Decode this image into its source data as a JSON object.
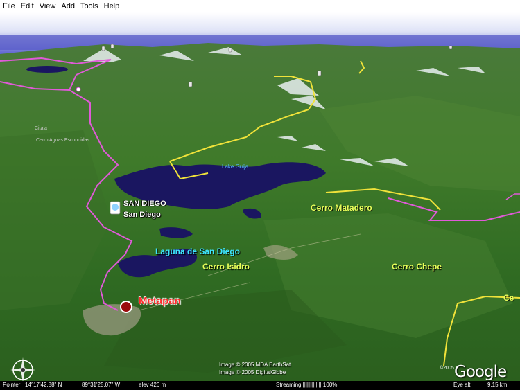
{
  "menu": {
    "items": [
      "File",
      "Edit",
      "View",
      "Add",
      "Tools",
      "Help"
    ]
  },
  "map": {
    "place_labels": {
      "san_diego_upper": "SAN DIEGO",
      "san_diego_lower": "San Diego",
      "metapan": "Metapan",
      "laguna": "Laguna de San Diego",
      "cerro_isidro": "Cerro Isidro",
      "cerro_matadero": "Cerro Matadero",
      "cerro_chepe": "Cerro Chepe",
      "cerro_partial": "Ce",
      "lake_guija": "Lake Guija",
      "cerro_aguas": "Cerro Aguas Escondidas",
      "small_town": "Citala"
    },
    "colors": {
      "border_magenta": "#e05ad8",
      "border_yellow": "#f0e23a",
      "water": "#1a1660",
      "sky": "#6a6fd8"
    }
  },
  "credits": {
    "line1": "Image © 2005 MDA EarthSat",
    "line2": "Image © 2005 DigitalGlobe"
  },
  "logo": {
    "year": "©2005",
    "text": "Google"
  },
  "compass": {
    "icon": "compass-rose-icon"
  },
  "status": {
    "pointer_label": "Pointer",
    "lat": "14°17'42.88\"  N",
    "lon": "89°31'25.07\"  W",
    "elev": "elev  426 m",
    "streaming": "Streaming ||||||||||||| 100%",
    "eye_alt": "Eye  alt",
    "eye_alt_value": "9.15 km"
  }
}
